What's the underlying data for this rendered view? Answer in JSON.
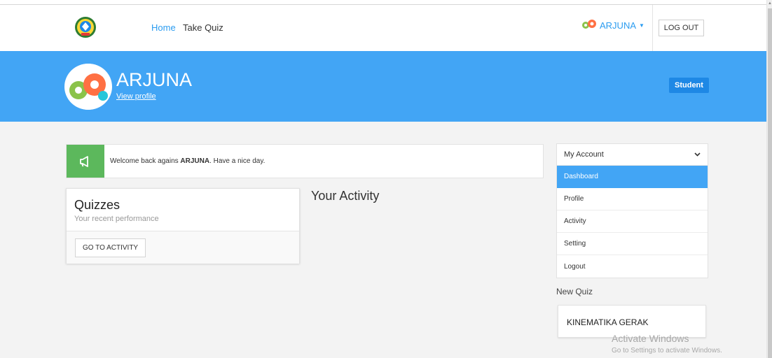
{
  "nav": {
    "home": "Home",
    "take_quiz": "Take Quiz",
    "user": "ARJUNA",
    "logout": "LOG OUT",
    "logo_icon": "school-crest-icon",
    "user_icon": "gears-icon"
  },
  "banner": {
    "name": "ARJUNA",
    "view_profile": "View profile",
    "role": "Student",
    "avatar_icon": "gears-avatar-icon"
  },
  "alert": {
    "prefix": "Welcome back agains ",
    "name": "ARJUNA",
    "suffix": ". Have a nice day.",
    "icon": "megaphone-icon"
  },
  "quizzes": {
    "title": "Quizzes",
    "subtitle": "Your recent performance",
    "button": "GO TO ACTIVITY"
  },
  "activity": {
    "title": "Your Activity"
  },
  "sidebar": {
    "header": "My Account",
    "items": [
      {
        "label": "Dashboard",
        "active": true
      },
      {
        "label": "Profile",
        "active": false
      },
      {
        "label": "Activity",
        "active": false
      },
      {
        "label": "Setting",
        "active": false
      },
      {
        "label": "Logout",
        "active": false
      }
    ]
  },
  "new_quiz": {
    "title": "New Quiz",
    "items": [
      {
        "label": "KINEMATIKA GERAK"
      }
    ]
  },
  "watermark": {
    "title": "Activate Windows",
    "subtitle": "Go to Settings to activate Windows."
  },
  "colors": {
    "primary": "#42a5f5",
    "link": "#2b9cf0",
    "success": "#5cb85c",
    "badge": "#1e88e5"
  }
}
